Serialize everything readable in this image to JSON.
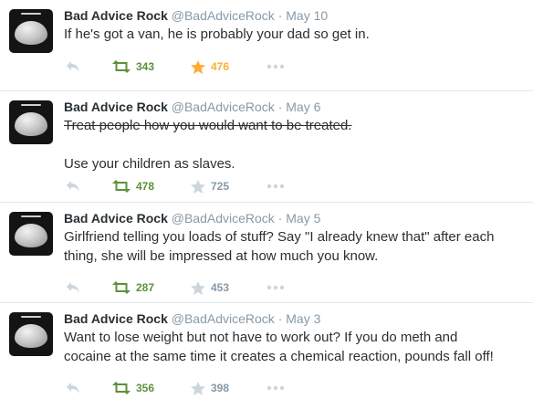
{
  "tweets": [
    {
      "name": "Bad Advice Rock",
      "handle": "@BadAdviceRock",
      "separator": "·",
      "date": "May 10",
      "text_lines": [
        "If he's got a van, he is probably your dad so get in."
      ],
      "struck_line": "",
      "retweets": "343",
      "favorites": "476",
      "favorited": true
    },
    {
      "name": "Bad Advice Rock",
      "handle": "@BadAdviceRock",
      "separator": "·",
      "date": "May 6",
      "text_lines": [
        "",
        "",
        "Use your children as slaves."
      ],
      "struck_line": "Treat people how you would want to be treated.",
      "retweets": "478",
      "favorites": "725",
      "favorited": false
    },
    {
      "name": "Bad Advice Rock",
      "handle": "@BadAdviceRock",
      "separator": "·",
      "date": "May 5",
      "text_lines": [
        "Girlfriend telling you loads of stuff? Say \"I already knew that\" after each",
        "thing, she will be impressed at how much you know."
      ],
      "struck_line": "",
      "retweets": "287",
      "favorites": "453",
      "favorited": false
    },
    {
      "name": "Bad Advice Rock",
      "handle": "@BadAdviceRock",
      "separator": "·",
      "date": "May 3",
      "text_lines": [
        "Want to lose weight but not have to work out? If you do meth and",
        "cocaine at the same time it creates a chemical reaction, pounds fall off!"
      ],
      "struck_line": "",
      "retweets": "356",
      "favorites": "398",
      "favorited": false
    }
  ],
  "colors": {
    "name": "#292f33",
    "muted": "#8899a6",
    "retweet": "#5c913b",
    "favorite_active": "#ffac33",
    "icon": "#ccd6dd",
    "divider": "#e1e8ed"
  },
  "icons": {
    "reply": "reply-icon",
    "retweet": "retweet-icon",
    "favorite": "star-icon",
    "more": "more-dots-icon"
  }
}
